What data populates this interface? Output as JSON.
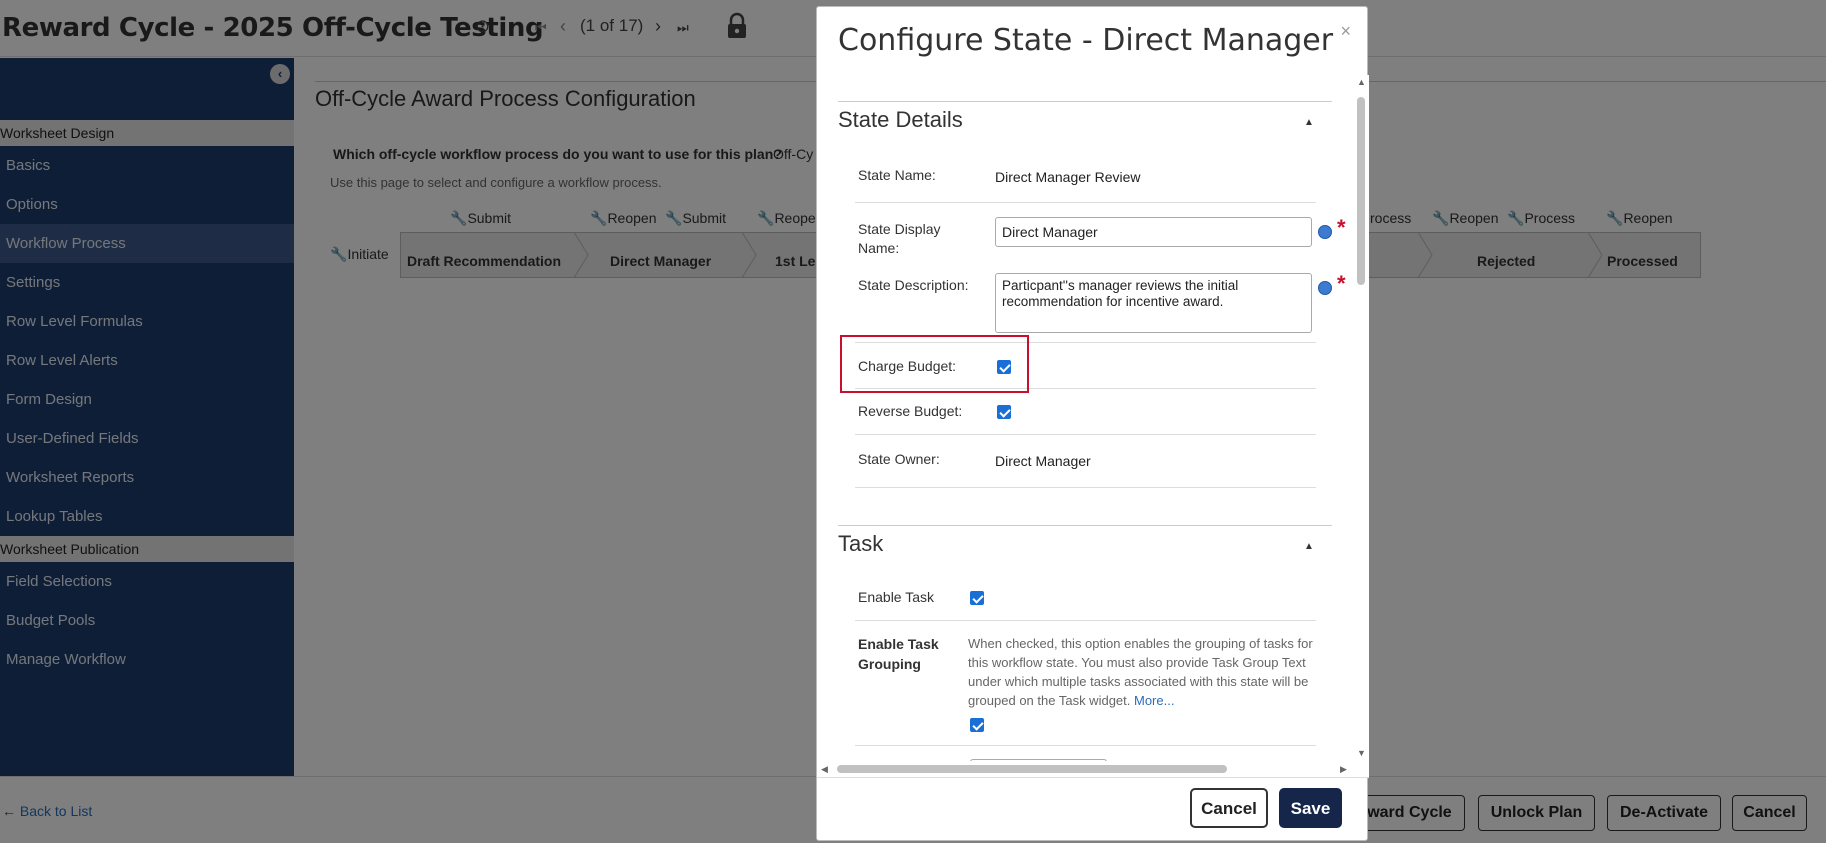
{
  "header": {
    "title": "Reward Cycle - 2025 Off-Cycle Testing",
    "pager_text": "(1 of 17)"
  },
  "sidebar": {
    "section1": "Worksheet Design",
    "items1": [
      "Basics",
      "Options",
      "Workflow Process",
      "Settings",
      "Row Level Formulas",
      "Row Level Alerts",
      "Form Design",
      "User-Defined Fields",
      "Worksheet Reports",
      "Lookup Tables"
    ],
    "section2": "Worksheet Publication",
    "items2": [
      "Field Selections",
      "Budget Pools",
      "Manage Workflow"
    ]
  },
  "main": {
    "heading": "Off-Cycle Award Process Configuration",
    "question": "Which off-cycle workflow process do you want to use for this plan?",
    "question_value": "Off-Cy",
    "hint": "Use this page to select and configure a workflow process.",
    "initiate": "Initiate",
    "actions": {
      "submit1": "Submit",
      "reopen1": "Reopen",
      "submit2": "Submit",
      "reopen2": "Reopen",
      "process1": "rocess",
      "reopen3": "Reopen",
      "process2": "Process",
      "reopen4": "Reopen"
    },
    "steps": {
      "draft": "Draft Recommendation",
      "direct": "Direct Manager",
      "first": "1st Le",
      "rejected": "Rejected",
      "processed": "Processed"
    }
  },
  "footer": {
    "back": "Back to List",
    "buttons": {
      "reward": "eward Cycle",
      "unlock": "Unlock Plan",
      "deactivate": "De-Activate",
      "cancel": "Cancel"
    }
  },
  "modal": {
    "title": "Configure State - Direct Manager",
    "close": "×",
    "state_details": {
      "title": "State Details",
      "state_name_label": "State Name:",
      "state_name_value": "Direct Manager Review",
      "display_name_label": "State Display Name:",
      "display_name_value": "Direct Manager",
      "description_label": "State Description:",
      "description_value": "Particpant''s manager reviews the initial recommendation for incentive award.",
      "charge_budget_label": "Charge Budget:",
      "reverse_budget_label": "Reverse Budget:",
      "owner_label": "State Owner:",
      "owner_value": "Direct Manager"
    },
    "task": {
      "title": "Task",
      "enable_task_label": "Enable Task",
      "grouping_label": "Enable Task Grouping",
      "grouping_desc": "When checked, this option enables the grouping of tasks for this workflow state. You must also provide Task Group Text under which multiple tasks associated with this state will be grouped on the Task widget.",
      "more": "More..."
    },
    "buttons": {
      "cancel": "Cancel",
      "save": "Save"
    }
  }
}
